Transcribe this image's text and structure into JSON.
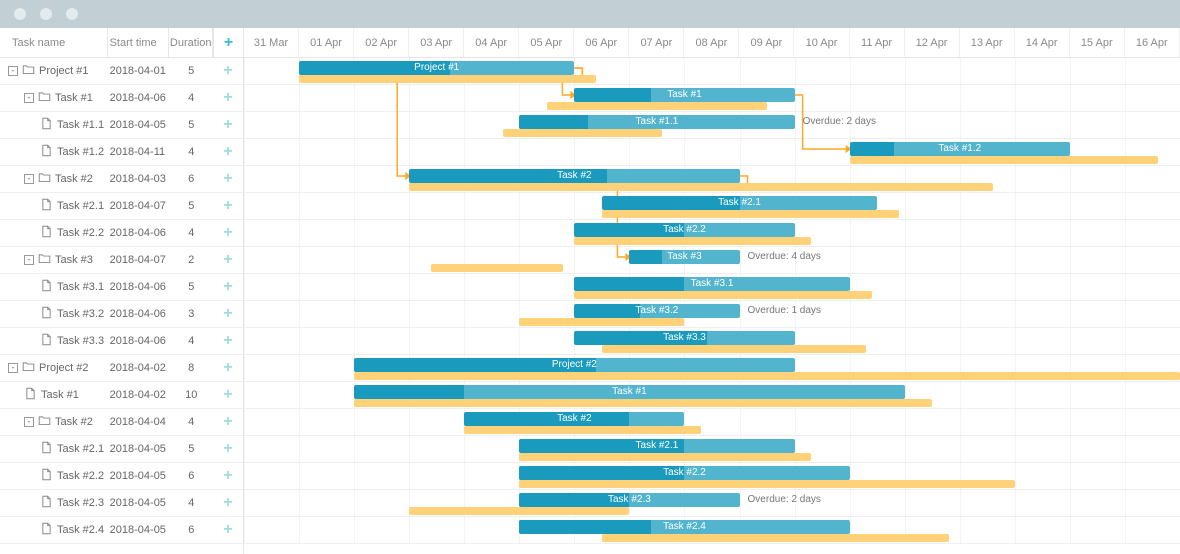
{
  "columns": {
    "name": "Task name",
    "start": "Start time",
    "duration": "Duration"
  },
  "dates": [
    "31 Mar",
    "01 Apr",
    "02 Apr",
    "03 Apr",
    "04 Apr",
    "05 Apr",
    "06 Apr",
    "07 Apr",
    "08 Apr",
    "09 Apr",
    "10 Apr",
    "11 Apr",
    "12 Apr",
    "13 Apr",
    "14 Apr",
    "15 Apr",
    "16 Apr"
  ],
  "dayWidth": 55.06,
  "overdue_prefix": "Overdue: ",
  "rows": [
    {
      "id": "r0",
      "indent": 0,
      "type": "folder",
      "expand": true,
      "name": "Project #1",
      "start": "2018-04-01",
      "dur": "5",
      "bar": {
        "s": 1,
        "d": 5,
        "p": 0.55
      },
      "base": {
        "s": 1,
        "d": 5.4
      }
    },
    {
      "id": "r1",
      "indent": 1,
      "type": "folder",
      "expand": true,
      "name": "Task #1",
      "start": "2018-04-06",
      "dur": "4",
      "bar": {
        "s": 6,
        "d": 4,
        "p": 0.35
      },
      "base": {
        "s": 5.5,
        "d": 4
      }
    },
    {
      "id": "r2",
      "indent": 2,
      "type": "file",
      "name": "Task #1.1",
      "start": "2018-04-05",
      "dur": "5",
      "bar": {
        "s": 5,
        "d": 5,
        "p": 0.25
      },
      "base": {
        "s": 4.7,
        "d": 2.9
      },
      "overdue": "2 days"
    },
    {
      "id": "r3",
      "indent": 2,
      "type": "file",
      "name": "Task #1.2",
      "start": "2018-04-11",
      "dur": "4",
      "bar": {
        "s": 11,
        "d": 4,
        "p": 0.2
      },
      "base": {
        "s": 11,
        "d": 5.6
      }
    },
    {
      "id": "r4",
      "indent": 1,
      "type": "folder",
      "expand": true,
      "name": "Task #2",
      "start": "2018-04-03",
      "dur": "6",
      "bar": {
        "s": 3,
        "d": 6,
        "p": 0.6
      },
      "base": {
        "s": 3,
        "d": 10.6
      }
    },
    {
      "id": "r5",
      "indent": 2,
      "type": "file",
      "name": "Task #2.1",
      "start": "2018-04-07",
      "dur": "5",
      "bar": {
        "s": 6.5,
        "d": 5,
        "p": 0.5
      },
      "base": {
        "s": 6.5,
        "d": 5.4
      }
    },
    {
      "id": "r6",
      "indent": 2,
      "type": "file",
      "name": "Task #2.2",
      "start": "2018-04-06",
      "dur": "4",
      "bar": {
        "s": 6,
        "d": 4,
        "p": 0.5
      },
      "base": {
        "s": 6,
        "d": 4.3
      }
    },
    {
      "id": "r7",
      "indent": 1,
      "type": "folder",
      "expand": true,
      "name": "Task #3",
      "start": "2018-04-07",
      "dur": "2",
      "bar": {
        "s": 7,
        "d": 2,
        "p": 0.3
      },
      "base": {
        "s": 3.4,
        "d": 2.4
      },
      "overdue": "4 days"
    },
    {
      "id": "r8",
      "indent": 2,
      "type": "file",
      "name": "Task #3.1",
      "start": "2018-04-06",
      "dur": "5",
      "bar": {
        "s": 6,
        "d": 5,
        "p": 0.4
      },
      "base": {
        "s": 6,
        "d": 5.4
      }
    },
    {
      "id": "r9",
      "indent": 2,
      "type": "file",
      "name": "Task #3.2",
      "start": "2018-04-06",
      "dur": "3",
      "bar": {
        "s": 6,
        "d": 3,
        "p": 0.4
      },
      "base": {
        "s": 5,
        "d": 3
      },
      "overdue": "1 days"
    },
    {
      "id": "r10",
      "indent": 2,
      "type": "file",
      "name": "Task #3.3",
      "start": "2018-04-06",
      "dur": "4",
      "bar": {
        "s": 6,
        "d": 4,
        "p": 0.6
      },
      "base": {
        "s": 6.5,
        "d": 4.8
      }
    },
    {
      "id": "r11",
      "indent": 0,
      "type": "folder",
      "expand": true,
      "name": "Project #2",
      "start": "2018-04-02",
      "dur": "8",
      "bar": {
        "s": 2,
        "d": 8,
        "p": 0.55
      },
      "base": {
        "s": 2,
        "d": 15
      }
    },
    {
      "id": "r12",
      "indent": 1,
      "type": "file",
      "name": "Task #1",
      "start": "2018-04-02",
      "dur": "10",
      "bar": {
        "s": 2,
        "d": 10,
        "p": 0.2
      },
      "base": {
        "s": 2,
        "d": 10.5
      }
    },
    {
      "id": "r13",
      "indent": 1,
      "type": "folder",
      "expand": true,
      "name": "Task #2",
      "start": "2018-04-04",
      "dur": "4",
      "bar": {
        "s": 4,
        "d": 4,
        "p": 0.75
      },
      "base": {
        "s": 4,
        "d": 4.3
      }
    },
    {
      "id": "r14",
      "indent": 2,
      "type": "file",
      "name": "Task #2.1",
      "start": "2018-04-05",
      "dur": "5",
      "bar": {
        "s": 5,
        "d": 5,
        "p": 0.6
      },
      "base": {
        "s": 5,
        "d": 5.3
      }
    },
    {
      "id": "r15",
      "indent": 2,
      "type": "file",
      "name": "Task #2.2",
      "start": "2018-04-05",
      "dur": "6",
      "bar": {
        "s": 5,
        "d": 6,
        "p": 0.5
      },
      "base": {
        "s": 5,
        "d": 9
      }
    },
    {
      "id": "r16",
      "indent": 2,
      "type": "file",
      "name": "Task #2.3",
      "start": "2018-04-05",
      "dur": "4",
      "bar": {
        "s": 5,
        "d": 4,
        "p": 0.5
      },
      "base": {
        "s": 3,
        "d": 4
      },
      "overdue": "2 days"
    },
    {
      "id": "r17",
      "indent": 2,
      "type": "file",
      "name": "Task #2.4",
      "start": "2018-04-05",
      "dur": "6",
      "bar": {
        "s": 5,
        "d": 6,
        "p": 0.4
      },
      "base": {
        "s": 6.5,
        "d": 6.3
      }
    }
  ],
  "links": [
    {
      "from": "r0",
      "to": "r1"
    },
    {
      "from": "r0",
      "to": "r4"
    },
    {
      "from": "r4",
      "to": "r7"
    },
    {
      "from": "r1",
      "to": "r3"
    }
  ]
}
